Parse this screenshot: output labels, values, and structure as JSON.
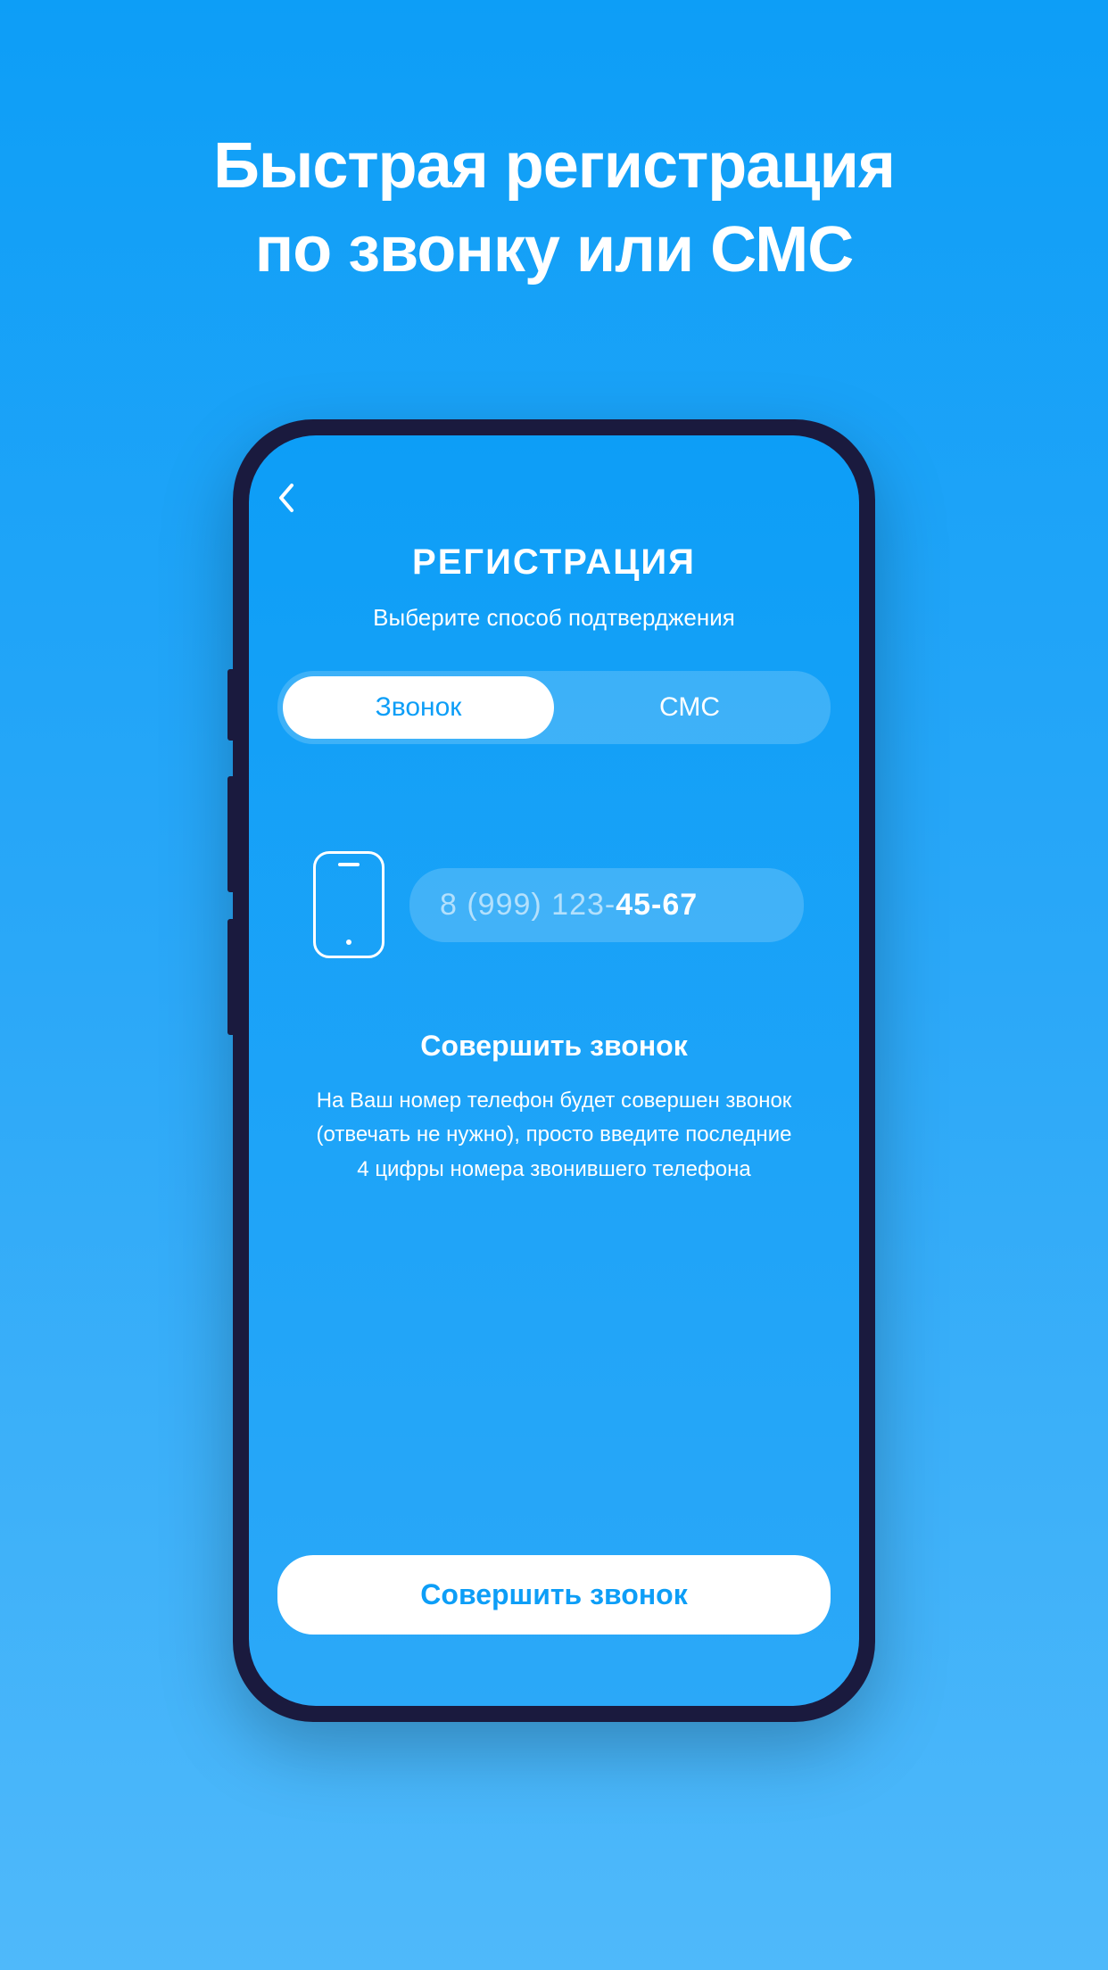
{
  "hero": {
    "title_line1": "Быстрая регистрация",
    "title_line2": "по звонку или СМС"
  },
  "screen": {
    "title": "РЕГИСТРАЦИЯ",
    "subtitle": "Выберите способ подтверджения",
    "toggle": {
      "option1": "Звонок",
      "option2": "СМС"
    },
    "phone_input": {
      "dim_part": "8 (999) 123-",
      "bright_part": "45-67"
    },
    "action": {
      "title": "Совершить звонок",
      "description_line1": "На Ваш номер телефон будет совершен звонок",
      "description_line2": "(отвечать не нужно), просто введите последние",
      "description_line3": "4 цифры номера звонившего телефона"
    },
    "primary_button": "Совершить звонок"
  }
}
